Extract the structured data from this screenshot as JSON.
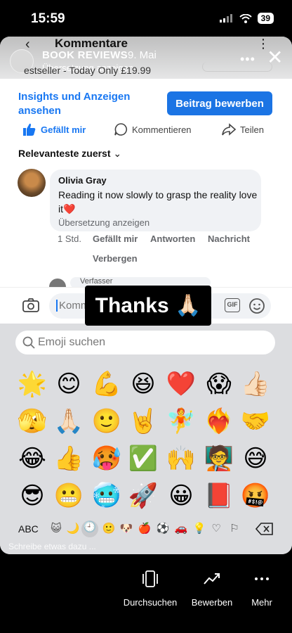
{
  "status_bar": {
    "time": "15:59",
    "battery": "39"
  },
  "header": {
    "title": "Kommentare",
    "back_glyph": "‹",
    "more_glyph": "⋮"
  },
  "story": {
    "username": "BOOK REVIEWS",
    "date": "9. Mai",
    "subtitle": "Übersetzung anzeigen",
    "bestseller_text": "estseller - Today Only £19.99",
    "more_glyph": "•••",
    "close_glyph": "✕"
  },
  "post": {
    "insights_link": "Insights und Anzeigen ansehen",
    "promote_button": "Beitrag bewerben",
    "actions": {
      "like": "Gefällt mir",
      "comment": "Kommentieren",
      "share": "Teilen"
    },
    "sort_label": "Relevanteste zuerst",
    "sort_chevron": "⌄"
  },
  "comment": {
    "author": "Olivia Gray",
    "text": "Reading it now slowly to grasp the reality love it❤️",
    "translate": "Übersetzung anzeigen",
    "time": "1 Std.",
    "like": "Gefällt mir",
    "reply": "Antworten",
    "message": "Nachricht",
    "hide": "Verbergen"
  },
  "next_comment": {
    "snippet": "Verfasser"
  },
  "composer": {
    "placeholder": "Komm",
    "gif_label": "GIF"
  },
  "caption_sticker": {
    "text": "Thanks 🙏🏻"
  },
  "keyboard": {
    "search_placeholder": "Emoji suchen",
    "emoji_rows": [
      [
        "🌟",
        "😊",
        "💪",
        "😆",
        "❤️",
        "😱",
        "👍🏻"
      ],
      [
        "🫣",
        "🙏🏻",
        "🙂",
        "🤘",
        "🧚",
        "❤️‍🔥",
        "🤝"
      ],
      [
        "😂",
        "👍",
        "🥵",
        "✅",
        "🙌",
        "🧑‍🏫",
        "😅"
      ],
      [
        "😎",
        "😬",
        "🥶",
        "🚀",
        "😀",
        "📕",
        "🤬"
      ]
    ],
    "abc_label": "ABC",
    "categories": [
      "😺",
      "🌙",
      "🕘",
      "🙂",
      "🐶",
      "🍎",
      "⚽",
      "🚗",
      "💡",
      "♡",
      "⚐"
    ],
    "delete_glyph": "⌫",
    "hint": "Schreibe etwas dazu ..."
  },
  "bottom_bar": {
    "items": [
      {
        "label": "Durchsuchen",
        "icon": "browse-icon"
      },
      {
        "label": "Bewerben",
        "icon": "trend-icon"
      },
      {
        "label": "Mehr",
        "icon": "more-icon"
      }
    ]
  },
  "colors": {
    "facebook_blue": "#1877f2",
    "button_blue": "#1b74e4",
    "keyboard_bg": "#dcdde0"
  }
}
